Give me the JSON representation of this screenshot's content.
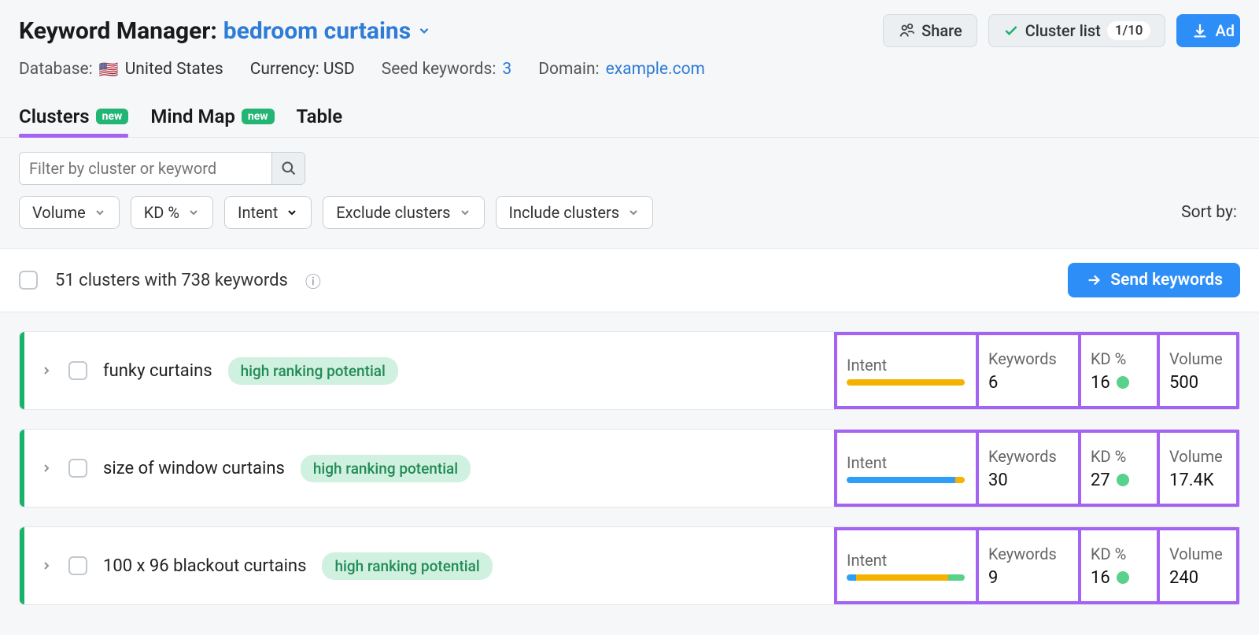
{
  "header": {
    "title_prefix": "Keyword Manager:",
    "keyword": "bedroom curtains",
    "share_label": "Share",
    "cluster_list_label": "Cluster list",
    "cluster_list_count": "1/10",
    "add_label": "Ad"
  },
  "meta": {
    "database_label": "Database:",
    "database_value": "United States",
    "currency_label": "Currency: USD",
    "seed_label": "Seed keywords:",
    "seed_value": "3",
    "domain_label": "Domain:",
    "domain_value": "example.com"
  },
  "tabs": {
    "clusters": "Clusters",
    "mindmap": "Mind Map",
    "table": "Table",
    "new_badge": "new"
  },
  "filters": {
    "search_placeholder": "Filter by cluster or keyword",
    "volume": "Volume",
    "kd": "KD %",
    "intent": "Intent",
    "exclude": "Exclude clusters",
    "include": "Include clusters",
    "sort_by": "Sort by:"
  },
  "summary": {
    "text": "51 clusters with 738 keywords",
    "send_label": "Send keywords"
  },
  "metric_labels": {
    "intent": "Intent",
    "keywords": "Keywords",
    "kd": "KD %",
    "volume": "Volume"
  },
  "clusters": [
    {
      "name": "funky curtains",
      "potential": "high ranking potential",
      "keywords": "6",
      "kd": "16",
      "volume": "500",
      "intent_segments": [
        {
          "color": "#f5b301",
          "pct": 100
        }
      ]
    },
    {
      "name": "size of window curtains",
      "potential": "high ranking potential",
      "keywords": "30",
      "kd": "27",
      "volume": "17.4K",
      "intent_segments": [
        {
          "color": "#2e9ef7",
          "pct": 92
        },
        {
          "color": "#f5b301",
          "pct": 8
        }
      ]
    },
    {
      "name": "100 x 96 blackout curtains",
      "potential": "high ranking potential",
      "keywords": "9",
      "kd": "16",
      "volume": "240",
      "intent_segments": [
        {
          "color": "#2e9ef7",
          "pct": 8
        },
        {
          "color": "#f5b301",
          "pct": 78
        },
        {
          "color": "#58d18a",
          "pct": 14
        }
      ]
    }
  ]
}
